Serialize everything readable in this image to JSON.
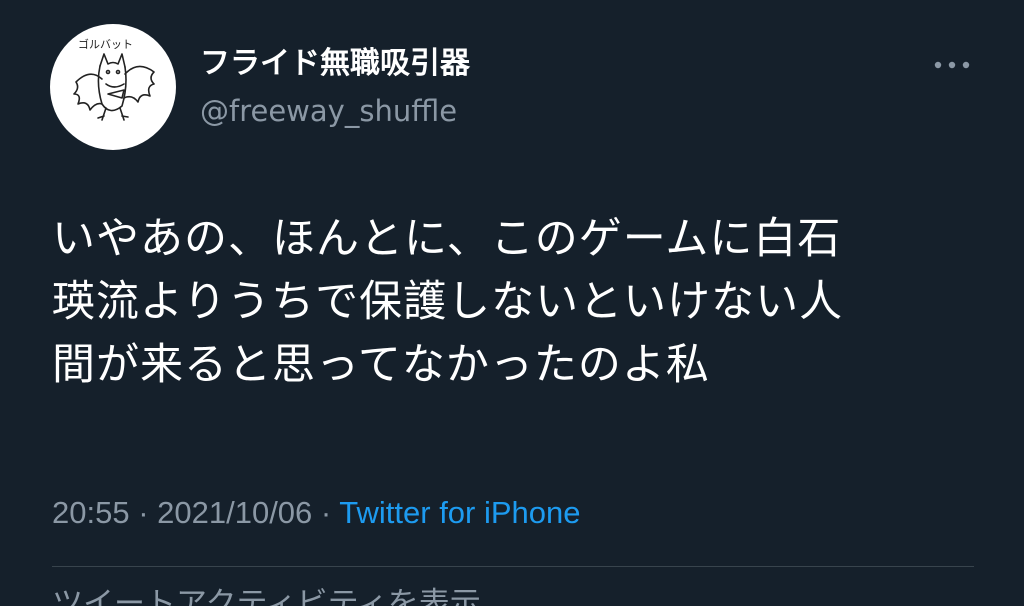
{
  "user": {
    "display_name": "フライド無職吸引器",
    "handle": "@freeway_shuffle",
    "avatar_text": "ゴルバット"
  },
  "tweet": {
    "text_lines": [
      "いやあの、ほんとに、このゲームに白石",
      "瑛流よりうちで保護しないといけない人",
      "間が来ると思ってなかったのよ私"
    ]
  },
  "meta": {
    "time": "20:55",
    "separator": " · ",
    "date": "2021/10/06",
    "source": "Twitter for iPhone"
  },
  "actions": {
    "view_activity": "ツイートアクティビティを表示"
  },
  "icons": {
    "more": "more-horizontal-icon"
  },
  "colors": {
    "background": "#15202b",
    "primary_text": "#ffffff",
    "secondary_text": "#8b98a5",
    "link": "#1d9bf0",
    "divider": "#38444d"
  }
}
